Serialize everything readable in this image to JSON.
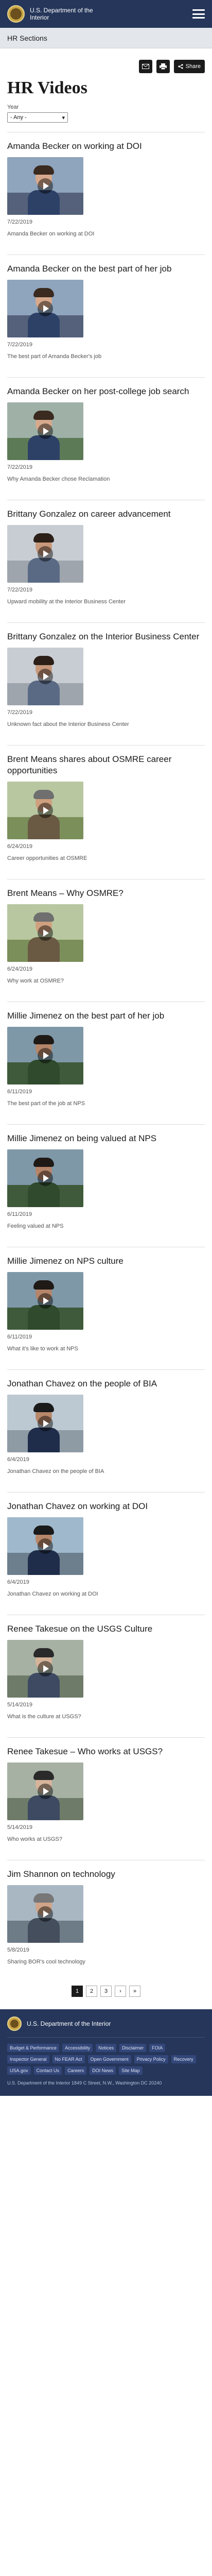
{
  "header": {
    "title_line1": "U.S. Department of the",
    "title_line2": "Interior"
  },
  "section": {
    "title": "HR Sections"
  },
  "share": {
    "email_icon": "email-icon",
    "print_icon": "print-icon",
    "share_label": "Share"
  },
  "page": {
    "title": "HR Videos"
  },
  "filter": {
    "label": "Year",
    "value": "- Any -"
  },
  "videos": [
    {
      "title": "Amanda Becker on working at DOI",
      "date": "7/22/2019",
      "desc": "Amanda Becker on working at DOI"
    },
    {
      "title": "Amanda Becker on the best part of her job",
      "date": "7/22/2019",
      "desc": "The best part of Amanda Becker's job"
    },
    {
      "title": "Amanda Becker on her post-college job search",
      "date": "7/22/2019",
      "desc": "Why Amanda Becker chose Reclamation"
    },
    {
      "title": "Brittany Gonzalez on career advancement",
      "date": "7/22/2019",
      "desc": "Upward mobility at the Interior Business Center"
    },
    {
      "title": "Brittany Gonzalez on the Interior Business Center",
      "date": "7/22/2019",
      "desc": "Unknown fact about the Interior Business Center"
    },
    {
      "title": "Brent Means shares about OSMRE career opportunities",
      "date": "6/24/2019",
      "desc": "Career opportunities at OSMRE"
    },
    {
      "title": "Brent Means – Why OSMRE?",
      "date": "6/24/2019",
      "desc": "Why work at OSMRE?"
    },
    {
      "title": "Millie Jimenez on the best part of her job",
      "date": "6/11/2019",
      "desc": "The best part of the job at NPS"
    },
    {
      "title": "Millie Jimenez on being valued at NPS",
      "date": "6/11/2019",
      "desc": "Feeling valued at NPS"
    },
    {
      "title": "Millie Jimenez on NPS culture",
      "date": "6/11/2019",
      "desc": "What it's like to work at NPS"
    },
    {
      "title": "Jonathan Chavez on the people of BIA",
      "date": "6/4/2019",
      "desc": "Jonathan Chavez on the people of BIA"
    },
    {
      "title": "Jonathan Chavez on working at DOI",
      "date": "6/4/2019",
      "desc": "Jonathan Chavez on working at DOI"
    },
    {
      "title": "Renee Takesue on the USGS Culture",
      "date": "5/14/2019",
      "desc": "What is the culture at USGS?"
    },
    {
      "title": "Renee Takesue – Who works at USGS?",
      "date": "5/14/2019",
      "desc": "Who works at USGS?"
    },
    {
      "title": "Jim Shannon on technology",
      "date": "5/8/2019",
      "desc": "Sharing BOR's cool technology"
    }
  ],
  "pager": {
    "pages": [
      "1",
      "2",
      "3"
    ],
    "next": "›",
    "last": "»"
  },
  "footer": {
    "title": "U.S. Department of the Interior",
    "links": [
      "Budget & Performance",
      "Accessibility",
      "Notices",
      "Disclaimer",
      "FOIA",
      "Inspector General",
      "No FEAR Act",
      "Open Government",
      "Privacy Policy",
      "Recovery",
      "USA.gov",
      "Contact Us",
      "Careers",
      "DOI News",
      "Site Map"
    ],
    "address": "U.S. Department of the Interior 1849 C Street, N.W., Washington DC 20240"
  }
}
